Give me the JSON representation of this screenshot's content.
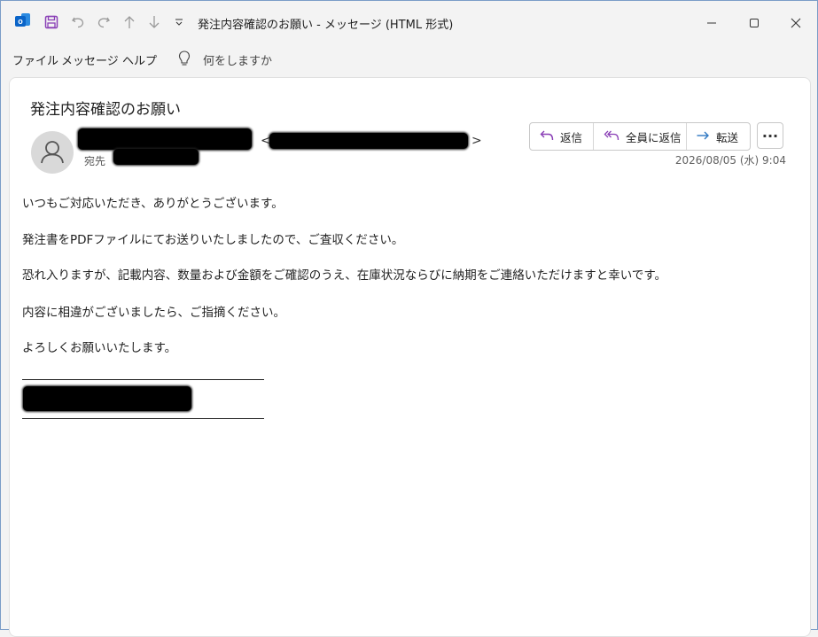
{
  "window": {
    "title": "発注内容確認のお願い  -  メッセージ (HTML 形式)"
  },
  "titlebar_icons": [
    "outlook-logo",
    "save-icon",
    "undo-icon",
    "redo-icon",
    "up-arrow-icon",
    "down-arrow-icon",
    "quick-access-dropdown-icon",
    "minimize-icon",
    "maximize-icon",
    "close-icon"
  ],
  "menu": {
    "items": [
      "ファイル",
      "メッセージ",
      "ヘルプ"
    ],
    "tell_me": "何をしますか"
  },
  "message": {
    "subject": "発注内容確認のお願い",
    "to_label": "宛先",
    "date": "2026/08/05 (水) 9:04",
    "actions": {
      "reply": "返信",
      "reply_all": "全員に返信",
      "forward": "転送"
    },
    "body": [
      "いつもご対応いただき、ありがとうございます。",
      "発注書をPDFファイルにてお送りいたしましたので、ご査収ください。",
      "恐れ入りますが、記載内容、数量および金額をご確認のうえ、在庫状況ならびに納期をご連絡いただけますと幸いです。",
      "内容に相違がございましたら、ご指摘ください。",
      "よろしくお願いいたします。"
    ]
  },
  "colors": {
    "reply_icon": "#8a3fb6",
    "forward_icon": "#2f78c2",
    "outlook_blue": "#0a64c8"
  }
}
